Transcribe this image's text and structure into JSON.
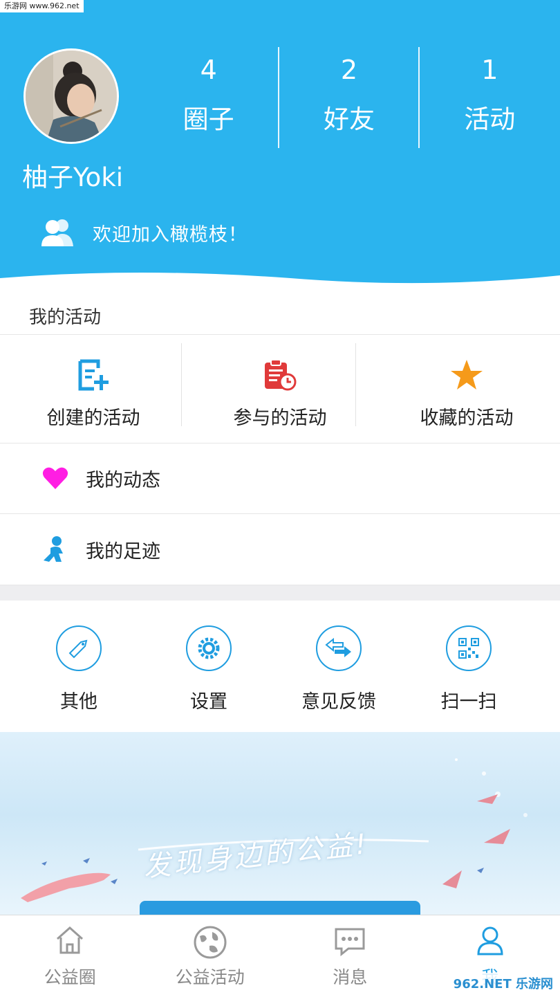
{
  "watermark_top": "乐游网 www.962.net",
  "profile": {
    "username": "柚子Yoki",
    "welcome": "欢迎加入橄榄枝！"
  },
  "stats": [
    {
      "value": "4",
      "label": "圈子"
    },
    {
      "value": "2",
      "label": "好友"
    },
    {
      "value": "1",
      "label": "活动"
    }
  ],
  "my_activities": {
    "title": "我的活动",
    "items": [
      {
        "label": "创建的活动",
        "icon": "create-activity-icon"
      },
      {
        "label": "参与的活动",
        "icon": "clipboard-clock-icon"
      },
      {
        "label": "收藏的活动",
        "icon": "star-icon"
      }
    ]
  },
  "list": [
    {
      "label": "我的动态",
      "icon": "heart-icon"
    },
    {
      "label": "我的足迹",
      "icon": "walking-person-icon"
    }
  ],
  "tools": [
    {
      "label": "其他",
      "icon": "tag-icon"
    },
    {
      "label": "设置",
      "icon": "gear-icon"
    },
    {
      "label": "意见反馈",
      "icon": "arrows-exchange-icon"
    },
    {
      "label": "扫一扫",
      "icon": "qr-code-icon"
    }
  ],
  "banner": {
    "slogan": "发现身边的公益!"
  },
  "bottom_nav": [
    {
      "label": "公益圈",
      "icon": "home-icon",
      "active": false
    },
    {
      "label": "公益活动",
      "icon": "globe-icon",
      "active": false
    },
    {
      "label": "消息",
      "icon": "message-icon",
      "active": false
    },
    {
      "label": "我",
      "icon": "user-icon",
      "active": true
    }
  ],
  "watermark_bottom": "962.NET 乐游网",
  "colors": {
    "header_blue": "#2bb4ee",
    "accent_blue": "#1f9de0",
    "heart": "#ff1ee3",
    "star": "#f59a1a",
    "clipboard_red": "#e03a3a"
  }
}
